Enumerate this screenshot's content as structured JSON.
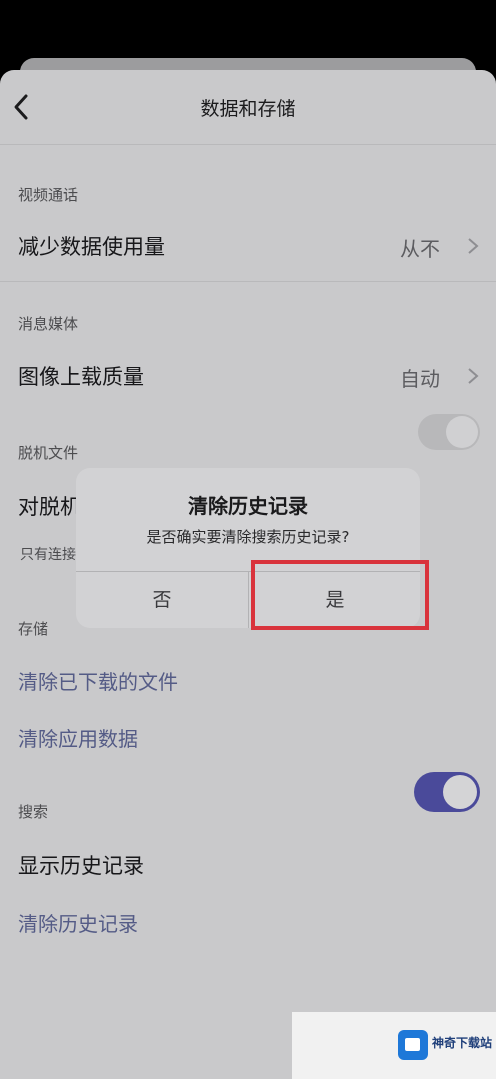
{
  "header": {
    "title": "数据和存储"
  },
  "sections": {
    "video_call": {
      "label": "视频通话",
      "row": {
        "label": "减少数据使用量",
        "value": "从不"
      }
    },
    "media": {
      "label": "消息媒体",
      "row": {
        "label": "图像上载质量",
        "value": "自动"
      }
    },
    "offline": {
      "label": "脱机文件",
      "row_label_visible": "对脱机",
      "hint_visible": "只有连接",
      "toggle_on": false
    },
    "storage": {
      "label": "存储",
      "clear_downloads": "清除已下载的文件",
      "clear_app_data": "清除应用数据"
    },
    "search": {
      "label": "搜索",
      "show_history": "显示历史记录",
      "show_history_on": true,
      "clear_history": "清除历史记录"
    }
  },
  "dialog": {
    "title": "清除历史记录",
    "message": "是否确实要清除搜索历史记录?",
    "no_label": "否",
    "yes_label": "是"
  },
  "watermark": {
    "text": "神奇下载站"
  },
  "colors": {
    "background": "#c9c9cb",
    "toggle_on": "#4a4a9a",
    "link": "#545b86",
    "highlight": "#d9333c"
  }
}
